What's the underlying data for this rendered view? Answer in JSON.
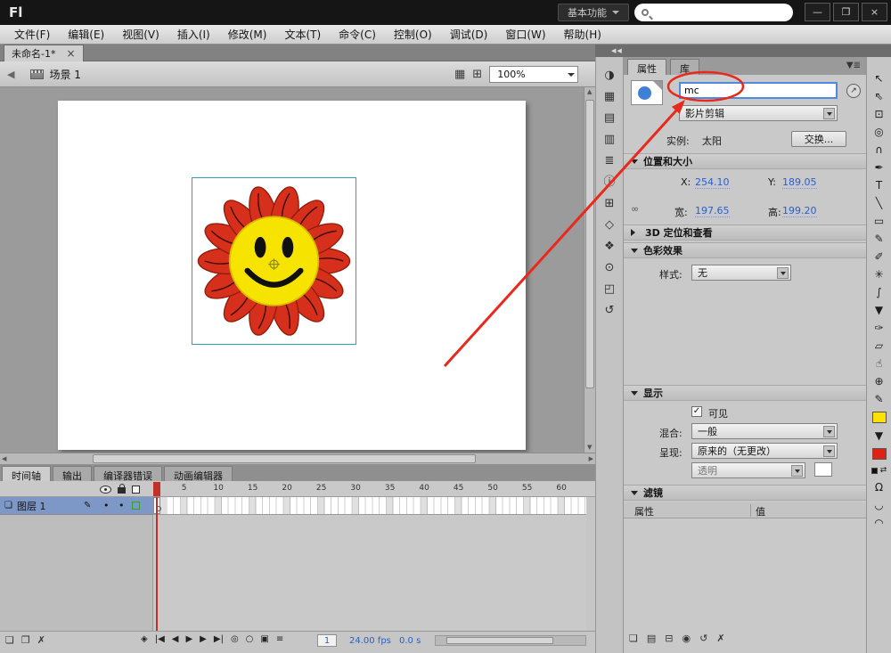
{
  "glyphs": {
    "close_x": "×",
    "minimize": "—",
    "restore": "❐",
    "check": "✓",
    "back": "◀",
    "collapse": "◀◀",
    "panel_menu": "▼≣",
    "pin": "↗",
    "pencil": "✎",
    "dot": "•",
    "link": "∞",
    "layer_doc": "❏",
    "edit_scene": "▦",
    "edit_symbol": "⊞",
    "scroll_left": "◀",
    "scroll_right": "▶",
    "scroll_up": "▲",
    "scroll_down": "▼",
    "swap_colors": "⇄",
    "snap_magnet": "Ω",
    "smooth": "◡",
    "straighten": "◠",
    "stroke_pencil": "✎",
    "fill_bucket": "▼"
  },
  "titlebar": {
    "logo": "Fl",
    "workspace": "基本功能",
    "search_value": ""
  },
  "menubar": {
    "items": [
      {
        "name": "menu-file",
        "label": "文件(F)"
      },
      {
        "name": "menu-edit",
        "label": "编辑(E)"
      },
      {
        "name": "menu-view",
        "label": "视图(V)"
      },
      {
        "name": "menu-insert",
        "label": "插入(I)"
      },
      {
        "name": "menu-modify",
        "label": "修改(M)"
      },
      {
        "name": "menu-text",
        "label": "文本(T)"
      },
      {
        "name": "menu-commands",
        "label": "命令(C)"
      },
      {
        "name": "menu-control",
        "label": "控制(O)"
      },
      {
        "name": "menu-debug",
        "label": "调试(D)"
      },
      {
        "name": "menu-window",
        "label": "窗口(W)"
      },
      {
        "name": "menu-help",
        "label": "帮助(H)"
      }
    ]
  },
  "doc_tab": {
    "title": "未命名-1*"
  },
  "edit_bar": {
    "scene": "场景 1",
    "zoom": "100%"
  },
  "stage_object": {
    "petal": "#d6301c",
    "petal_edge": "#8f1d0c",
    "center": "#f6e300",
    "center_edge": "#d9bb00",
    "selection": "#2ba3b4"
  },
  "panel_strip": {
    "icons": [
      {
        "name": "color-panel-icon",
        "glyph": "◑"
      },
      {
        "name": "swatches-panel-icon",
        "glyph": "▦"
      },
      {
        "name": "motion-presets-panel-icon",
        "glyph": "▤"
      },
      {
        "name": "project-panel-icon",
        "glyph": "▥"
      },
      {
        "name": "actions-panel-icon",
        "glyph": "≣"
      },
      {
        "name": "info-panel-icon",
        "glyph": "ⓘ"
      },
      {
        "name": "align-panel-icon",
        "glyph": "⊞"
      },
      {
        "name": "transform-panel-icon",
        "glyph": "◇"
      },
      {
        "name": "code-snippets-panel-icon",
        "glyph": "❖"
      },
      {
        "name": "components-panel-icon",
        "glyph": "⊙"
      },
      {
        "name": "motion-editor-panel-icon",
        "glyph": "◰"
      },
      {
        "name": "history-panel-icon",
        "glyph": "↺"
      }
    ]
  },
  "properties": {
    "tab_properties": "属性",
    "tab_library": "库",
    "instance_name": "mc",
    "behavior": "影片剪辑",
    "instance_label": "实例:",
    "instance_value": "太阳",
    "swap_button": "交换...",
    "sections": {
      "position_title": "位置和大小",
      "x_label": "X:",
      "x_value": "254.10",
      "y_label": "Y:",
      "y_value": "189.05",
      "w_label": "宽:",
      "w_value": "197.65",
      "h_label": "高:",
      "h_value": "199.20",
      "threed_title": "3D 定位和查看",
      "color_title": "色彩效果",
      "style_label": "样式:",
      "style_value": "无",
      "display_title": "显示",
      "visible_label": "可见",
      "blend_label": "混合:",
      "blend_value": "一般",
      "render_label": "呈现:",
      "render_value": "原来的（无更改）",
      "alpha_value": "透明",
      "filters_title": "滤镜",
      "filter_col_property": "属性",
      "filter_col_value": "值"
    },
    "bottom_icons": [
      {
        "name": "add-filter-icon",
        "glyph": "❏"
      },
      {
        "name": "filter-presets-icon",
        "glyph": "▤"
      },
      {
        "name": "filter-clipboard-icon",
        "glyph": "⊟"
      },
      {
        "name": "enable-filter-icon",
        "glyph": "◉"
      },
      {
        "name": "reset-filter-icon",
        "glyph": "↺"
      },
      {
        "name": "delete-filter-icon",
        "glyph": "✗"
      }
    ]
  },
  "timeline": {
    "tabs": [
      {
        "name": "tab-timeline",
        "label": "时间轴",
        "active": true
      },
      {
        "name": "tab-output",
        "label": "输出"
      },
      {
        "name": "tab-compiler-errors",
        "label": "编译器错误"
      },
      {
        "name": "tab-motion-editor",
        "label": "动画编辑器"
      }
    ],
    "layer_name": "图层 1",
    "ruler_numbers": [
      "5",
      "10",
      "15",
      "20",
      "25",
      "30",
      "35",
      "40",
      "45",
      "50",
      "55",
      "60"
    ],
    "layer_buttons": [
      {
        "name": "new-layer-button",
        "glyph": "❏"
      },
      {
        "name": "new-folder-button",
        "glyph": "❐"
      },
      {
        "name": "delete-layer-button",
        "glyph": "✗"
      }
    ],
    "controls": [
      {
        "name": "center-frame-button",
        "glyph": "◈"
      },
      {
        "name": "first-frame-button",
        "glyph": "|◀"
      },
      {
        "name": "prev-frame-button",
        "glyph": "◀"
      },
      {
        "name": "play-button",
        "glyph": "▶"
      },
      {
        "name": "next-frame-button",
        "glyph": "▶"
      },
      {
        "name": "last-frame-button",
        "glyph": "▶|"
      },
      {
        "name": "onion-skin-button",
        "glyph": "◎"
      },
      {
        "name": "onion-skin-outlines-button",
        "glyph": "○"
      },
      {
        "name": "edit-multiple-frames-button",
        "glyph": "▣"
      },
      {
        "name": "modify-markers-button",
        "glyph": "≡"
      }
    ],
    "current_frame": "1",
    "frame_rate": "24.00 fps",
    "elapsed_time": "0.0 s"
  },
  "tools": {
    "items": [
      {
        "name": "selection-tool",
        "glyph": "↖"
      },
      {
        "name": "subselection-tool",
        "glyph": "⇖"
      },
      {
        "name": "free-transform-tool",
        "glyph": "⊡"
      },
      {
        "name": "3d-rotation-tool",
        "glyph": "◎"
      },
      {
        "name": "lasso-tool",
        "glyph": "∩"
      },
      {
        "name": "pen-tool",
        "glyph": "✒"
      },
      {
        "name": "text-tool",
        "glyph": "T"
      },
      {
        "name": "line-tool",
        "glyph": "╲"
      },
      {
        "name": "rectangle-tool",
        "glyph": "▭"
      },
      {
        "name": "pencil-tool",
        "glyph": "✎"
      },
      {
        "name": "brush-tool",
        "glyph": "✐"
      },
      {
        "name": "deco-tool",
        "glyph": "✳"
      },
      {
        "name": "bone-tool",
        "glyph": "∫"
      },
      {
        "name": "paint-bucket-tool",
        "glyph": "▼"
      },
      {
        "name": "eyedropper-tool",
        "glyph": "✑"
      },
      {
        "name": "eraser-tool",
        "glyph": "▱"
      },
      {
        "name": "hand-tool",
        "glyph": "☝"
      },
      {
        "name": "zoom-tool",
        "glyph": "⊕"
      }
    ],
    "stroke_color": "#ffe100",
    "fill_color": "#e02214"
  },
  "annotation": {
    "color": "#e8291c"
  }
}
